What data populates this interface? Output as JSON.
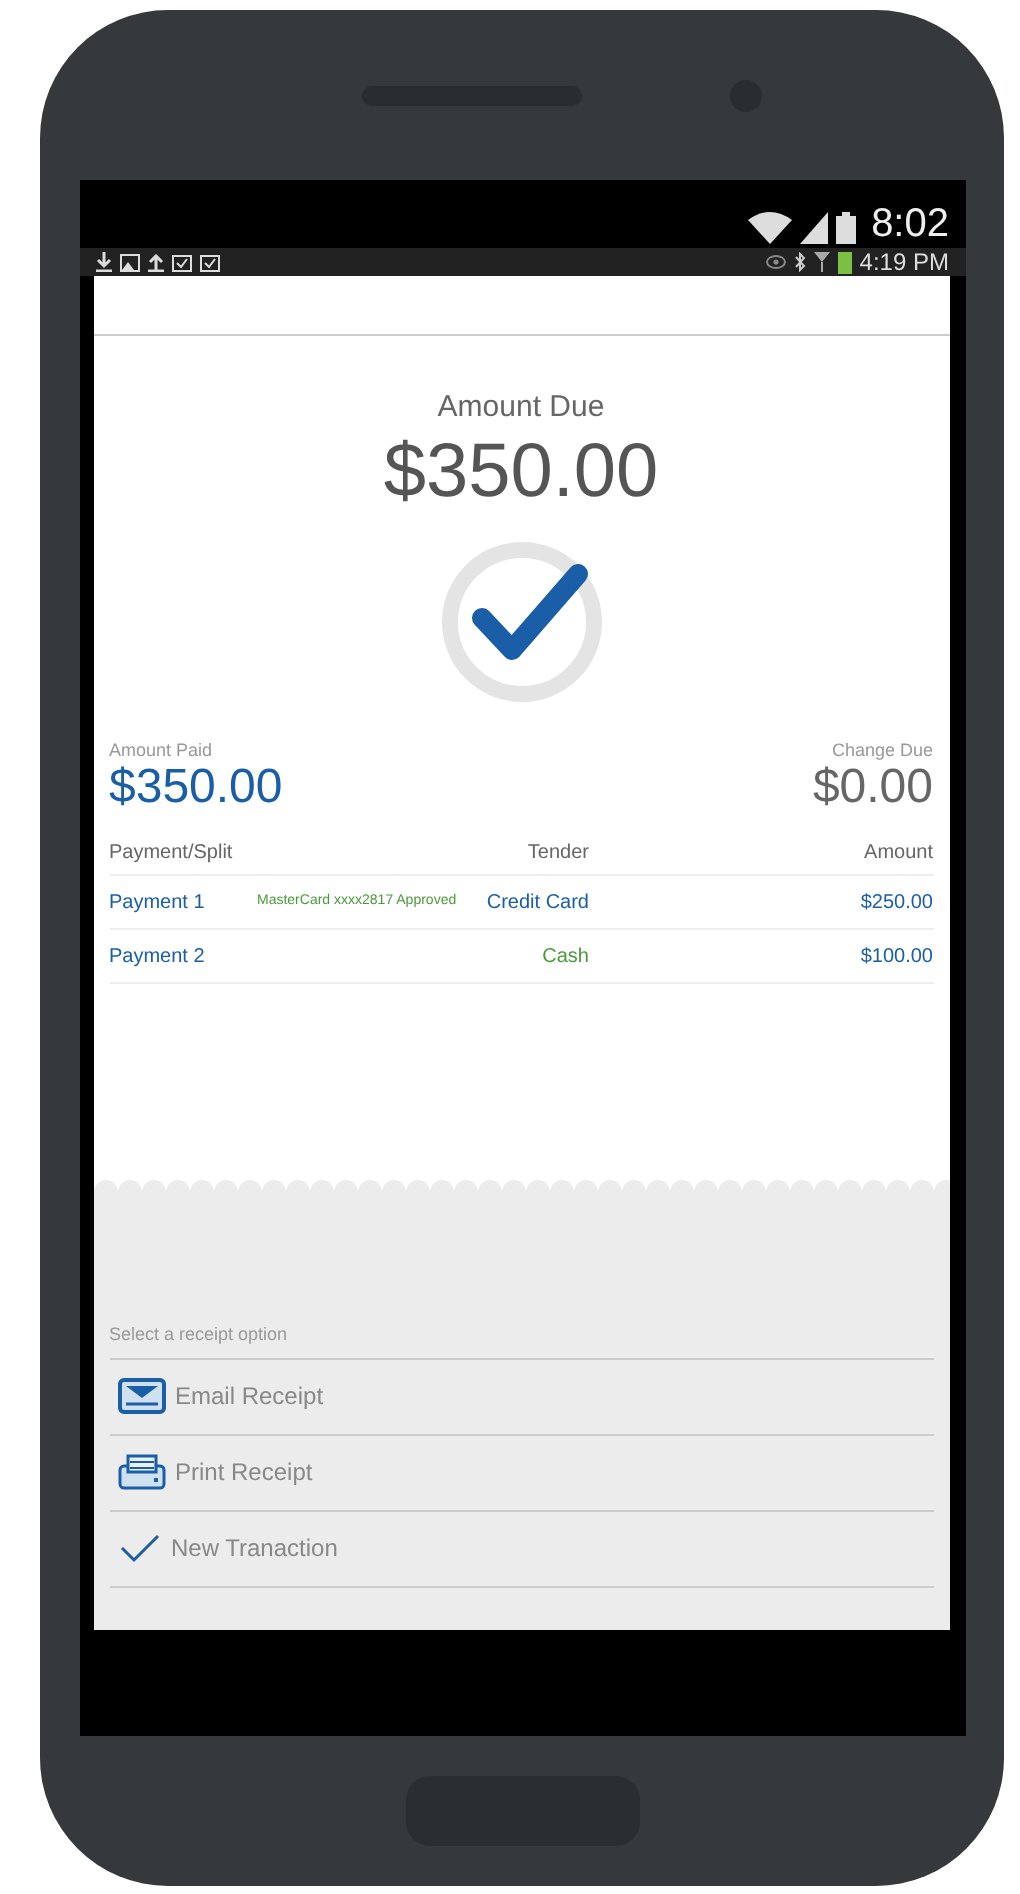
{
  "phone_status_bar": {
    "time": "8:02"
  },
  "app_status_bar": {
    "time": "4:19 PM"
  },
  "amount_due": {
    "label": "Amount Due",
    "value": "$350.00"
  },
  "amount_paid": {
    "label": "Amount Paid",
    "value": "$350.00"
  },
  "change_due": {
    "label": "Change Due",
    "value": "$0.00"
  },
  "table": {
    "columns": [
      "Payment/Split",
      "Tender",
      "Amount"
    ],
    "rows": [
      {
        "payment": "Payment 1",
        "note": "MasterCard xxxx2817 Approved",
        "tender": "Credit Card",
        "kind": "card",
        "amount": "$250.00"
      },
      {
        "payment": "Payment 2",
        "tender": "Cash",
        "kind": "cash",
        "amount": "$100.00"
      }
    ]
  },
  "receipt": {
    "prompt": "Select a receipt option",
    "options": [
      {
        "kind": "email",
        "label": "Email Receipt"
      },
      {
        "kind": "print",
        "label": "Print Receipt"
      },
      {
        "kind": "new",
        "label": "New Tranaction"
      }
    ]
  }
}
